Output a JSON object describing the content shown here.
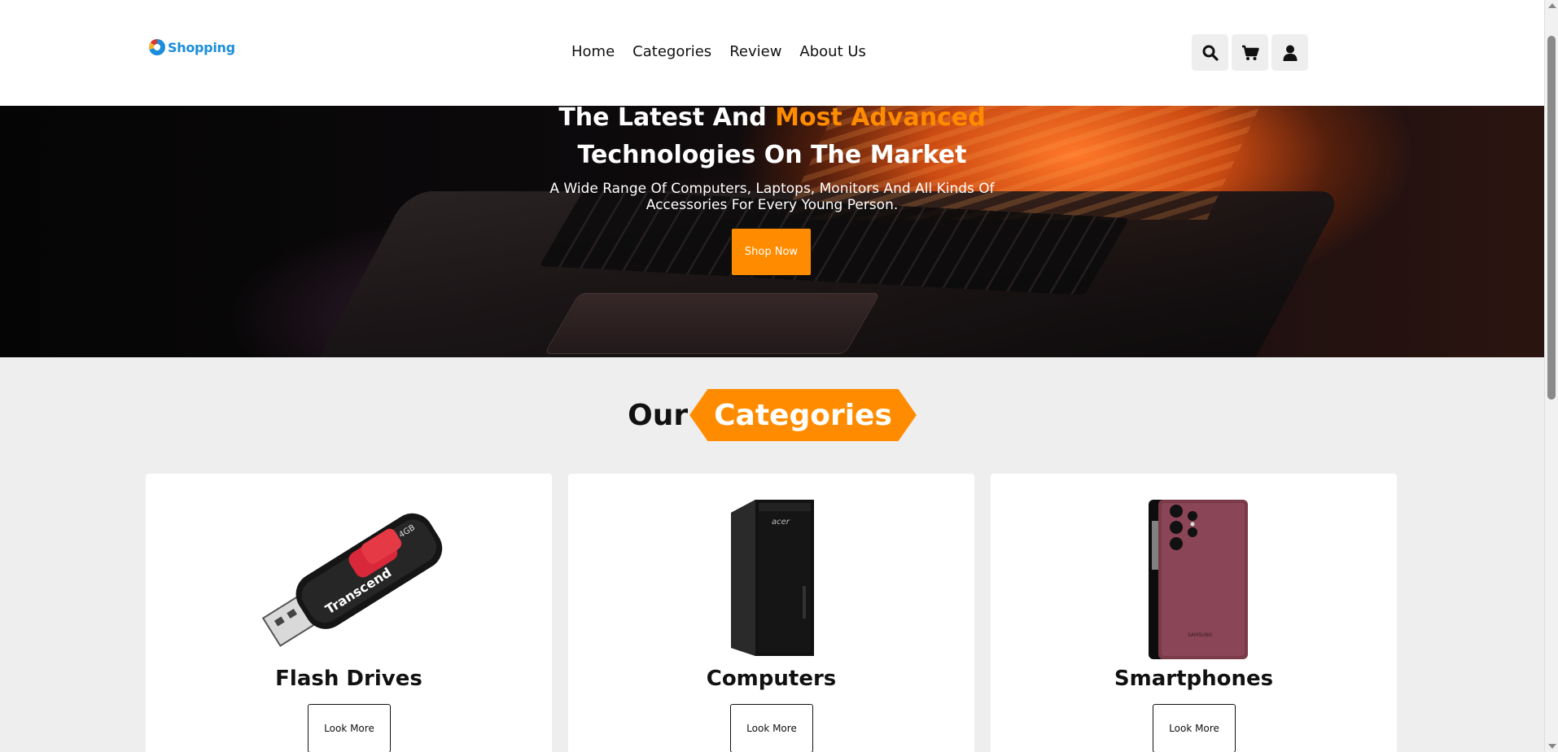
{
  "brand": {
    "name": "Shopping"
  },
  "nav": [
    "Home",
    "Categories",
    "Review",
    "About Us"
  ],
  "header_icons": [
    "search-icon",
    "cart-icon",
    "user-icon"
  ],
  "hero": {
    "title_line1_a": "The Latest And ",
    "title_line1_b": "Most Advanced",
    "title_line2": "Technologies On The Market",
    "subtitle_line1": "A Wide Range Of Computers, Laptops, Monitors And All Kinds Of",
    "subtitle_line2": "Accessories For Every Young Person.",
    "cta": "Shop Now"
  },
  "categories": {
    "heading_a": "Our",
    "heading_b": "Categories",
    "items": [
      {
        "name": "Flash Drives",
        "button": "Look More",
        "brand_text": "Transcend",
        "capacity": "4GB"
      },
      {
        "name": "Computers",
        "button": "Look More",
        "brand_text": "acer"
      },
      {
        "name": "Smartphones",
        "button": "Look More",
        "brand_text": "SAMSUNG"
      }
    ]
  },
  "colors": {
    "accent": "#ff8c00",
    "brand": "#1a8ddb",
    "page_bg": "#eeeeee"
  }
}
